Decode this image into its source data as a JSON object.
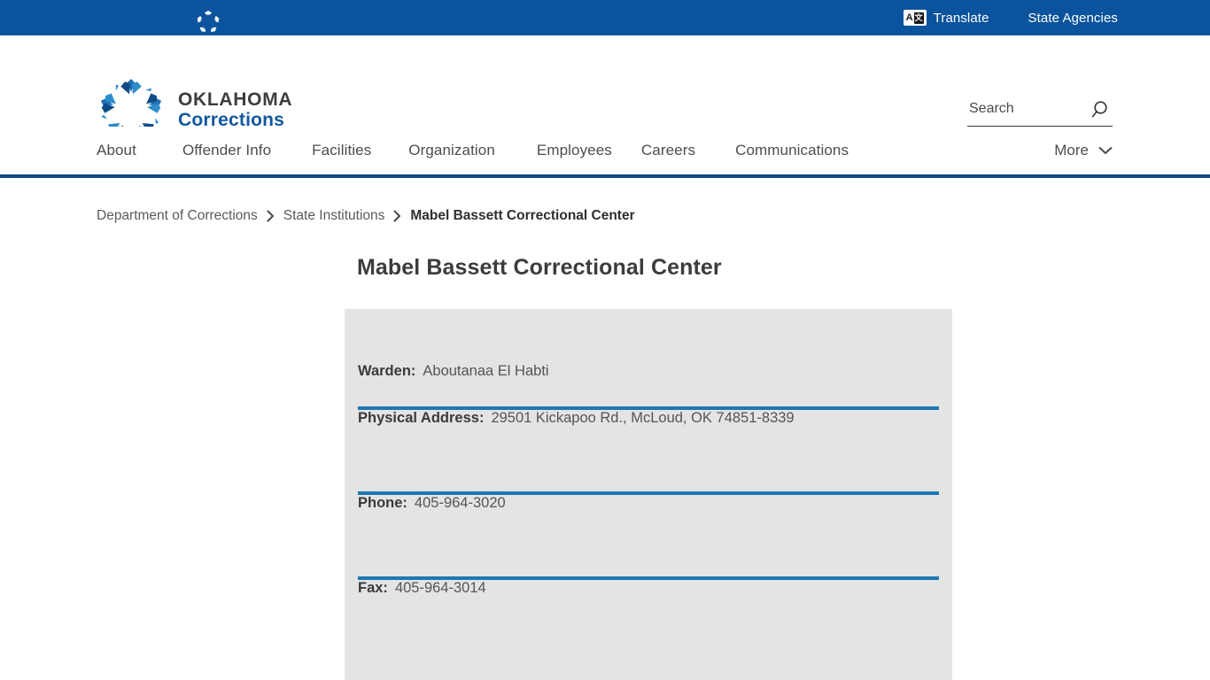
{
  "utility_bar": {
    "logo_icon": "oklahoma-star-icon",
    "translate": {
      "label": "Translate",
      "icon": "translate-icon",
      "icon_chars": [
        "A",
        "文"
      ]
    },
    "state_agencies": {
      "label": "State Agencies"
    },
    "bg_color": "#0b539c"
  },
  "header": {
    "brand": {
      "icon": "oklahoma-star-logo",
      "line1": "OKLAHOMA",
      "line2": "Corrections",
      "line1_color": "#3d3d3d",
      "line2_color": "#12589f"
    },
    "search": {
      "placeholder": "Search",
      "value": "",
      "icon": "search-icon"
    }
  },
  "nav": {
    "items": [
      {
        "label": "About"
      },
      {
        "label": "Offender Info"
      },
      {
        "label": "Facilities"
      },
      {
        "label": "Organization"
      },
      {
        "label": "Employees"
      },
      {
        "label": "Careers"
      },
      {
        "label": "Communications"
      }
    ],
    "more": {
      "label": "More",
      "icon": "chevron-down-icon"
    },
    "border_color": "#124a7e"
  },
  "breadcrumb": {
    "separator_icon": "chevron-right-icon",
    "items": [
      {
        "label": "Department of Corrections",
        "current": false
      },
      {
        "label": "State Institutions",
        "current": false
      },
      {
        "label": "Mabel Bassett Correctional Center",
        "current": true
      }
    ]
  },
  "main": {
    "page_title": "Mabel Bassett Correctional Center",
    "card": {
      "bg_color": "#e4e4e4",
      "divider_color": "#1f78b4",
      "rows": [
        {
          "label": "Warden:",
          "value": "Aboutanaa El Habti"
        },
        {
          "label": "Physical Address:",
          "value": "29501 Kickapoo Rd., McLoud, OK 74851-8339"
        },
        {
          "label": "Phone:",
          "value": "405-964-3020"
        },
        {
          "label": "Fax:",
          "value": "405-964-3014"
        }
      ]
    }
  }
}
